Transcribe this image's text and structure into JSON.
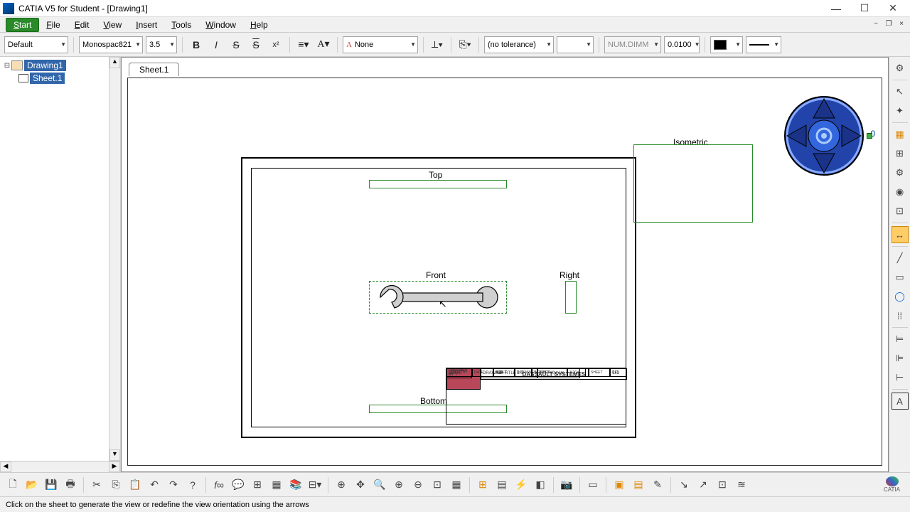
{
  "titlebar": {
    "text": "CATIA V5 for Student - [Drawing1]"
  },
  "mdi": {
    "min": "−",
    "max": "❐",
    "close": "×"
  },
  "menu": {
    "start": "Start",
    "file": "File",
    "edit": "Edit",
    "view": "View",
    "insert": "Insert",
    "tools": "Tools",
    "window": "Window",
    "help": "Help"
  },
  "toolbar": {
    "style": "Default",
    "font": "Monospac821",
    "size": "3.5",
    "bold": "B",
    "italic": "I",
    "strike": "S",
    "over": "S",
    "super": "x²",
    "anchor": "≡",
    "font_a": "A",
    "frame": "None",
    "tol": "(no tolerance)",
    "tolval": "",
    "dimstyle": "NUM.DIMM",
    "dimval": "0.0100"
  },
  "tree": {
    "root": "Drawing1",
    "sheet": "Sheet.1"
  },
  "tabs": {
    "sheet1": "Sheet.1"
  },
  "views": {
    "front": "Front",
    "top": "Top",
    "right": "Right",
    "bottom": "Bottom",
    "iso": "Isometric"
  },
  "compass": {
    "zero": "0"
  },
  "titleblock": {
    "company": "DASSAULT  SYSTEMES",
    "drawn": "DRAWN BY",
    "drawn_v": "Aditya",
    "checked": "CHECKED BY",
    "checked_v": "Aditya",
    "designed": "DESIGNED BY",
    "designed_v": "Aditya",
    "date": "DATE",
    "title": "DRAWING TITLE",
    "size": "SIZE",
    "size_v": "A3",
    "scale": "SCALE",
    "scale_v": "1:1",
    "weight": "WEIGHT(kg)",
    "sheet": "SHEET",
    "sheet_v": "1/1",
    "number": "DRAWING NUMBER",
    "xxx": "XXX",
    "rev": "REV"
  },
  "status": {
    "text": "Click on the sheet to generate the view or redefine the view orientation using the arrows"
  },
  "window": {
    "min": "—",
    "max": "☐",
    "close": "✕"
  }
}
